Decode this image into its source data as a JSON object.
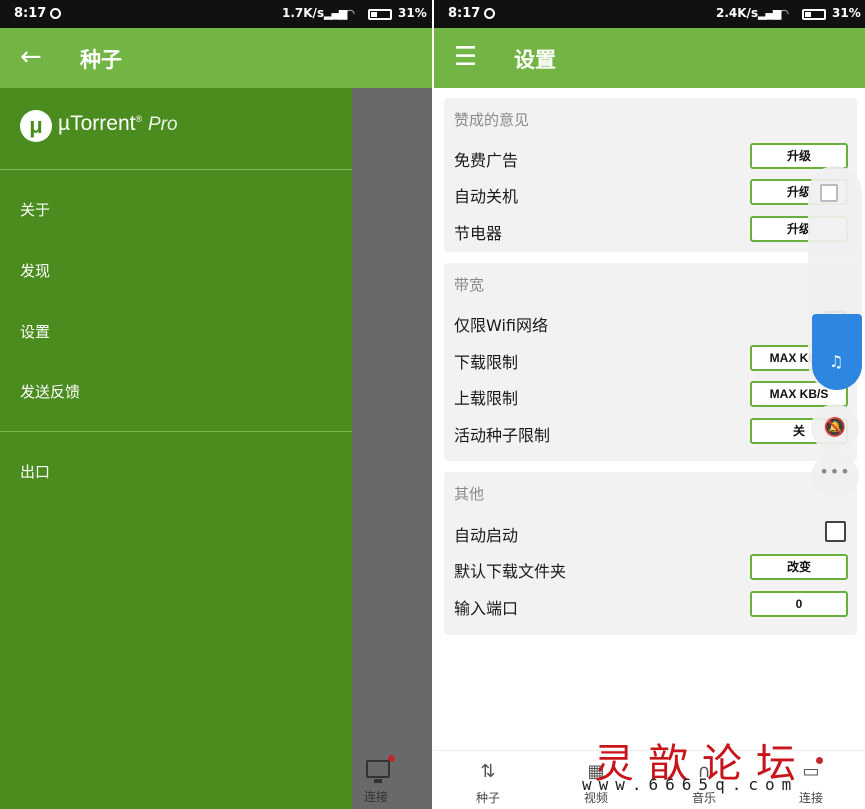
{
  "left": {
    "status": {
      "time": "8:17",
      "speed": "1.7K/s",
      "battery": "31%"
    },
    "appbar": {
      "back_icon": "arrow-left-icon",
      "title": "种子"
    },
    "drawer": {
      "brand_logo": "μ",
      "brand_name": "µTorrent",
      "brand_reg": "®",
      "brand_pro": "Pro",
      "items": [
        "关于",
        "发现",
        "设置",
        "发送反馈"
      ],
      "exit": "出口",
      "bg_color": "#4a8c1e"
    },
    "bottom": {
      "label": "连接"
    }
  },
  "right": {
    "status": {
      "time": "8:17",
      "speed": "2.4K/s",
      "battery": "31%"
    },
    "appbar": {
      "menu_icon": "hamburger-icon",
      "title": "设置",
      "color": "#72b545"
    },
    "sections": [
      {
        "header": "赞成的意见",
        "rows": [
          {
            "label": "免费广告",
            "control": "升级"
          },
          {
            "label": "自动关机",
            "control": "升级"
          },
          {
            "label": "节电器",
            "control": "升级"
          }
        ]
      },
      {
        "header": "带宽",
        "rows": [
          {
            "label": "仅限Wifi网络",
            "control": ""
          },
          {
            "label": "下载限制",
            "control": "MAX KB/S"
          },
          {
            "label": "上载限制",
            "control": "MAX KB/S"
          },
          {
            "label": "活动种子限制",
            "control": "关"
          }
        ]
      },
      {
        "header": "其他",
        "rows": [
          {
            "label": "自动启动",
            "control": ""
          },
          {
            "label": "默认下载文件夹",
            "control": "改变"
          },
          {
            "label": "输入端口",
            "control": "0"
          }
        ]
      }
    ],
    "bottom_nav": [
      {
        "label": "种子",
        "icon": "up-down-arrows-icon"
      },
      {
        "label": "视频",
        "icon": "film-icon"
      },
      {
        "label": "音乐",
        "icon": "headphones-icon"
      },
      {
        "label": "连接",
        "icon": "monitor-icon"
      }
    ],
    "watermark": {
      "title": "灵歆论坛",
      "url": "www.6665q.com"
    }
  }
}
